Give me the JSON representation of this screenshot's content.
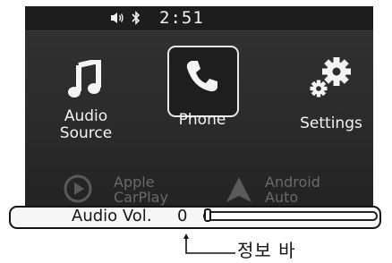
{
  "status_bar": {
    "time": "2:51",
    "icons": [
      "speaker-icon",
      "bluetooth-icon"
    ]
  },
  "apps": {
    "audio_source": {
      "label_line1": "Audio",
      "label_line2": "Source",
      "icon": "music-note-icon"
    },
    "phone": {
      "label": "Phone",
      "icon": "phone-handset-icon",
      "selected": true
    },
    "settings": {
      "label": "Settings",
      "icon": "gears-icon"
    },
    "apple_carplay": {
      "label_line1": "Apple",
      "label_line2": "CarPlay",
      "icon": "play-circle-icon",
      "disabled": true
    },
    "android_auto": {
      "label_line1": "Android",
      "label_line2": "Auto",
      "icon": "android-auto-icon",
      "disabled": true
    }
  },
  "info_bar": {
    "label": "Audio Vol.",
    "value": "0",
    "volume_level": 0
  },
  "callout": {
    "text": "정보 바"
  },
  "colors": {
    "screen_bg": "#2e2e2e",
    "text_active": "#f4f4f4",
    "text_disabled": "#6a6a6a",
    "info_bar_bg": "#f6f6f6"
  }
}
